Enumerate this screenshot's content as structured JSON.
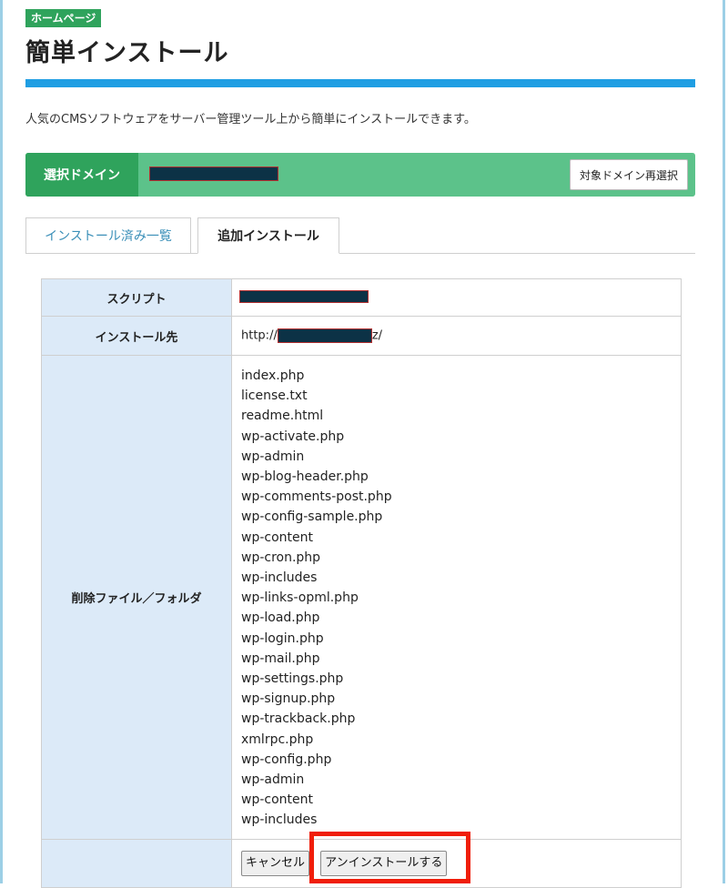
{
  "header": {
    "badge": "ホームページ",
    "title": "簡単インストール"
  },
  "description": "人気のCMSソフトウェアをサーバー管理ツール上から簡単にインストールできます。",
  "domain_bar": {
    "label": "選択ドメイン",
    "reselect_label": "対象ドメイン再選択"
  },
  "tabs": [
    {
      "label": "インストール済み一覧",
      "active": false
    },
    {
      "label": "追加インストール",
      "active": true
    }
  ],
  "table": {
    "script_label": "スクリプト",
    "destination_label": "インストール先",
    "destination_prefix": "http://",
    "destination_suffix": "z/",
    "delete_label": "削除ファイル／フォルダ",
    "files": [
      "index.php",
      "license.txt",
      "readme.html",
      "wp-activate.php",
      "wp-admin",
      "wp-blog-header.php",
      "wp-comments-post.php",
      "wp-config-sample.php",
      "wp-content",
      "wp-cron.php",
      "wp-includes",
      "wp-links-opml.php",
      "wp-load.php",
      "wp-login.php",
      "wp-mail.php",
      "wp-settings.php",
      "wp-signup.php",
      "wp-trackback.php",
      "xmlrpc.php",
      "wp-config.php",
      "wp-admin",
      "wp-content",
      "wp-includes"
    ]
  },
  "actions": {
    "cancel_label": "キャンセル",
    "uninstall_label": "アンインストールする"
  },
  "colors": {
    "badge_green": "#2fa35c",
    "domain_bar_green": "#5cc28a",
    "accent_blue": "#1f9ee3",
    "highlight_red": "#f01e0a"
  }
}
